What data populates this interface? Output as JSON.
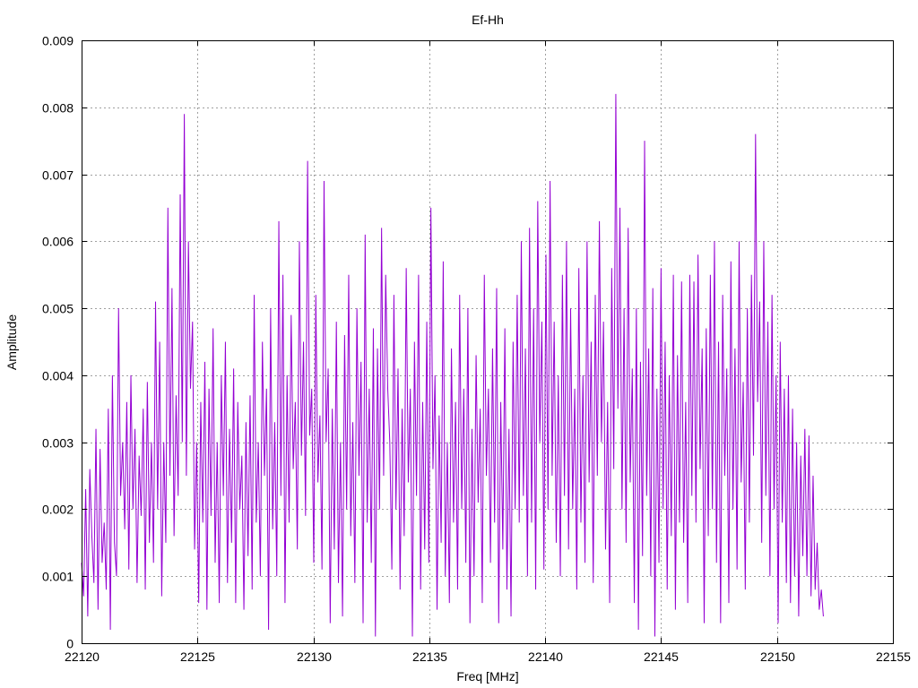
{
  "chart_data": {
    "type": "line",
    "title": "Ef-Hh",
    "xlabel": "Freq [MHz]",
    "ylabel": "Amplitude",
    "xlim": [
      22120,
      22155
    ],
    "ylim": [
      0,
      0.009
    ],
    "xticks": [
      "22120",
      "22125",
      "22130",
      "22135",
      "22140",
      "22145",
      "22150",
      "22155"
    ],
    "yticks": [
      "0",
      "0.001",
      "0.002",
      "0.003",
      "0.004",
      "0.005",
      "0.006",
      "0.007",
      "0.008",
      "0.009"
    ],
    "grid": true,
    "legend": "none",
    "series_color": "#9400d3",
    "x_range": [
      22120.0,
      22152.0
    ],
    "series": [
      {
        "values": [
          0.0012,
          0.0007,
          0.0023,
          0.0004,
          0.0026,
          0.0016,
          0.0009,
          0.0032,
          0.0005,
          0.0029,
          0.0012,
          0.0018,
          0.0008,
          0.0035,
          0.0002,
          0.004,
          0.0015,
          0.001,
          0.005,
          0.0022,
          0.003,
          0.0017,
          0.0036,
          0.0011,
          0.004,
          0.002,
          0.0032,
          0.0009,
          0.0028,
          0.0019,
          0.0035,
          0.0008,
          0.0039,
          0.0015,
          0.003,
          0.0012,
          0.0051,
          0.002,
          0.0045,
          0.0007,
          0.003,
          0.0015,
          0.0065,
          0.0025,
          0.0053,
          0.0016,
          0.0037,
          0.0022,
          0.0067,
          0.003,
          0.0079,
          0.0025,
          0.006,
          0.0038,
          0.0048,
          0.0014,
          0.003,
          0.0006,
          0.0036,
          0.0018,
          0.0042,
          0.0005,
          0.0038,
          0.0019,
          0.0047,
          0.0012,
          0.003,
          0.0006,
          0.004,
          0.0022,
          0.0045,
          0.0009,
          0.0032,
          0.0015,
          0.0041,
          0.0006,
          0.0036,
          0.002,
          0.0028,
          0.0005,
          0.0033,
          0.0013,
          0.0037,
          0.0008,
          0.0052,
          0.0018,
          0.003,
          0.001,
          0.0045,
          0.0025,
          0.0038,
          0.0002,
          0.005,
          0.0017,
          0.0033,
          0.001,
          0.0063,
          0.0022,
          0.0055,
          0.0006,
          0.004,
          0.0018,
          0.0049,
          0.0026,
          0.0036,
          0.0014,
          0.006,
          0.0028,
          0.0045,
          0.0019,
          0.0072,
          0.0031,
          0.0038,
          0.0012,
          0.0052,
          0.0024,
          0.0034,
          0.0011,
          0.0069,
          0.003,
          0.0041,
          0.0003,
          0.0035,
          0.0014,
          0.0048,
          0.0009,
          0.003,
          0.0004,
          0.0046,
          0.002,
          0.0055,
          0.0016,
          0.0033,
          0.0009,
          0.005,
          0.0025,
          0.0042,
          0.0003,
          0.0061,
          0.0018,
          0.0038,
          0.0012,
          0.0047,
          0.0001,
          0.0044,
          0.002,
          0.0062,
          0.0025,
          0.0055,
          0.0038,
          0.003,
          0.0011,
          0.0052,
          0.002,
          0.0041,
          0.0008,
          0.0035,
          0.0016,
          0.0056,
          0.0024,
          0.0038,
          0.0001,
          0.0045,
          0.0022,
          0.0055,
          0.0008,
          0.0036,
          0.0014,
          0.0048,
          0.0012,
          0.0065,
          0.0026,
          0.004,
          0.0005,
          0.0034,
          0.0015,
          0.0057,
          0.001,
          0.003,
          0.0006,
          0.0044,
          0.0018,
          0.0036,
          0.0008,
          0.0052,
          0.002,
          0.0038,
          0.0012,
          0.005,
          0.0003,
          0.0032,
          0.001,
          0.0043,
          0.0021,
          0.0035,
          0.0006,
          0.0055,
          0.0025,
          0.0038,
          0.0012,
          0.0044,
          0.0018,
          0.0053,
          0.0003,
          0.0036,
          0.0014,
          0.0047,
          0.0008,
          0.0032,
          0.0004,
          0.0045,
          0.002,
          0.0052,
          0.0018,
          0.006,
          0.0022,
          0.0044,
          0.001,
          0.0062,
          0.0018,
          0.005,
          0.0008,
          0.0066,
          0.003,
          0.0048,
          0.0011,
          0.0058,
          0.002,
          0.0069,
          0.0025,
          0.0048,
          0.0015,
          0.004,
          0.001,
          0.0055,
          0.0022,
          0.006,
          0.0014,
          0.005,
          0.002,
          0.0038,
          0.0008,
          0.0056,
          0.0018,
          0.004,
          0.0012,
          0.006,
          0.0024,
          0.0045,
          0.0009,
          0.0052,
          0.0025,
          0.0063,
          0.003,
          0.0048,
          0.0014,
          0.0036,
          0.0006,
          0.0056,
          0.0026,
          0.0082,
          0.0035,
          0.0065,
          0.002,
          0.005,
          0.0015,
          0.0062,
          0.0024,
          0.0041,
          0.0006,
          0.005,
          0.0002,
          0.0042,
          0.0013,
          0.0075,
          0.0022,
          0.0044,
          0.001,
          0.0053,
          0.0001,
          0.0038,
          0.0012,
          0.0056,
          0.002,
          0.0045,
          0.0008,
          0.004,
          0.0016,
          0.0055,
          0.0005,
          0.0043,
          0.0018,
          0.0054,
          0.0015,
          0.0036,
          0.0006,
          0.0055,
          0.0022,
          0.0054,
          0.0018,
          0.0058,
          0.0026,
          0.0044,
          0.0003,
          0.0047,
          0.0016,
          0.0055,
          0.002,
          0.006,
          0.0012,
          0.0045,
          0.0003,
          0.0052,
          0.0025,
          0.0041,
          0.0006,
          0.0057,
          0.002,
          0.0044,
          0.0011,
          0.006,
          0.0024,
          0.0039,
          0.0008,
          0.005,
          0.0018,
          0.0055,
          0.0028,
          0.0076,
          0.0036,
          0.0051,
          0.0015,
          0.006,
          0.0022,
          0.0048,
          0.001,
          0.0052,
          0.002,
          0.004,
          0.0003,
          0.0045,
          0.0018,
          0.0038,
          0.0009,
          0.004,
          0.0006,
          0.0035,
          0.001,
          0.003,
          0.0004,
          0.0028,
          0.0013,
          0.0032,
          0.001,
          0.0031,
          0.0007,
          0.0025,
          0.0008,
          0.0015,
          0.0005,
          0.0008,
          0.0004
        ]
      }
    ]
  }
}
